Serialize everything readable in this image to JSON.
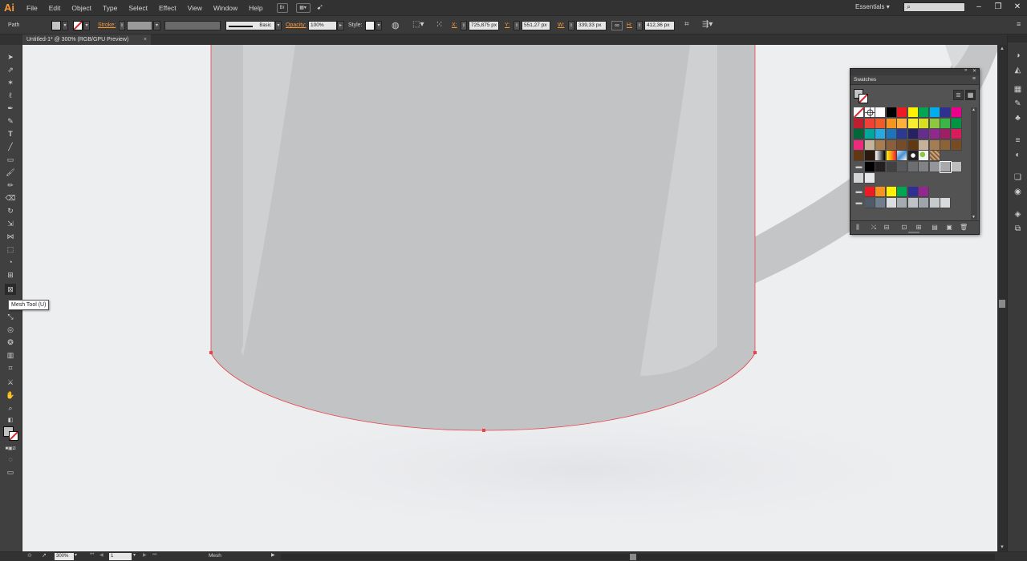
{
  "app": {
    "logo": "Ai",
    "menus": [
      "File",
      "Edit",
      "Object",
      "Type",
      "Select",
      "Effect",
      "View",
      "Window",
      "Help"
    ],
    "bridge_label": "Br",
    "workspace": "Essentials",
    "search_placeholder": ""
  },
  "control_bar": {
    "selection_type": "Path",
    "stroke_label": "Stroke:",
    "brush_label": "Basic",
    "opacity_label": "Opacity:",
    "opacity_value": "100%",
    "style_label": "Style:",
    "x_label": "X:",
    "x_value": "725,875 px",
    "y_label": "Y:",
    "y_value": "551,27 px",
    "w_label": "W:",
    "w_value": "339,33 px",
    "h_label": "H:",
    "h_value": "412,36 px"
  },
  "document": {
    "tab_title": "Untitled-1* @ 300% (RGB/GPU Preview)",
    "close_glyph": "×"
  },
  "tooltip": "Mesh Tool (U)",
  "swatches_panel": {
    "title": "Swatches",
    "menu_glyph": "≡",
    "rows": [
      [
        "none",
        "registration",
        "#ffffff",
        "#000000",
        "#ed1c24",
        "#fff200",
        "#00a651",
        "#00aeef",
        "#2e3192",
        "#ec008c"
      ],
      [
        "#be1e2d",
        "#ef4136",
        "#f15a29",
        "#f7941d",
        "#fbb040",
        "#f9ed32",
        "#d7df23",
        "#8dc63f",
        "#39b54a",
        "#009444"
      ],
      [
        "#006838",
        "#00a79d",
        "#27aae1",
        "#1c75bc",
        "#2b3990",
        "#262262",
        "#662d91",
        "#92278f",
        "#9e1f63",
        "#da1c5c"
      ],
      [
        "#ee2a7b",
        "#c2b59b",
        "#a97c50",
        "#8b5e3c",
        "#754c29",
        "#603913",
        "#c7b299",
        "#a67c52",
        "#8c6239",
        "#754c24"
      ],
      [
        "#603813",
        "#2b1a0c",
        "gradient-bw",
        "gradient-orange",
        "gradient-blue",
        "pattern-dots",
        "pattern-leaves",
        "pattern-brown"
      ],
      [
        "folder",
        "#000000",
        "#231f20",
        "#414042",
        "#58595b",
        "#6d6e71",
        "#808285",
        "#939598",
        "#a7a9ac",
        "#bcbec0"
      ],
      [
        "#d1d3d4",
        "#e6e7e8"
      ],
      [
        "folder",
        "#ed1c24",
        "#f7941d",
        "#fff200",
        "#00a651",
        "#2e3192",
        "#92278f"
      ],
      [
        "folder",
        "#4f5b66",
        "#6e7f8d",
        "#dcdde0",
        "#a6abb1",
        "#bfc3c7",
        "#9ea4aa",
        "#c7cacd",
        "#d8dadc"
      ]
    ]
  },
  "status_bar": {
    "zoom": "300%",
    "page": "1",
    "current_tool": "Mesh"
  },
  "colors": {
    "accent_orange": "#f89a3a",
    "selection_red": "#e8434a",
    "mug_body": "#c2c3c5",
    "mug_highlight": "#cfd0d2",
    "canvas_bg": "#edeef0"
  }
}
